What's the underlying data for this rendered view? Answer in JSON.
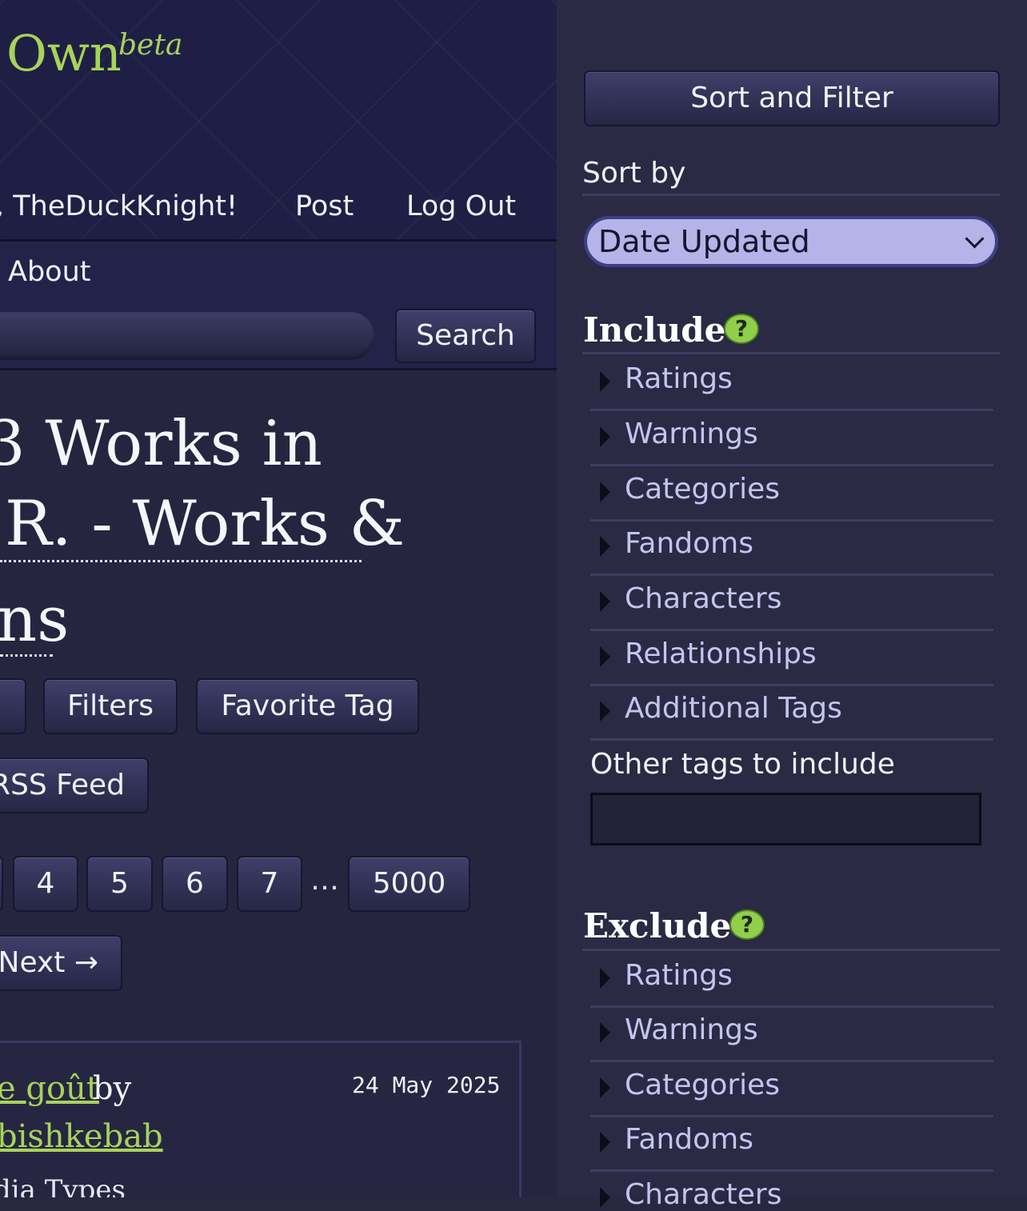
{
  "header": {
    "logo_text": "Own",
    "logo_badge": "beta",
    "greeting": ", TheDuckKnight!",
    "post_link": "Post",
    "logout_link": "Log Out"
  },
  "nav": {
    "about": "About",
    "search_button": "Search"
  },
  "page_heading": {
    "line1": "3 Works in",
    "line2": "R. - Works &",
    "line3": "ns"
  },
  "actions": {
    "partial": "",
    "filters": "Filters",
    "favorite_tag": "Favorite Tag",
    "rss_feed": "RSS Feed"
  },
  "pagination": {
    "partial": "",
    "pages": [
      "4",
      "5",
      "6",
      "7"
    ],
    "gap": "…",
    "last": "5000",
    "next": "Next →"
  },
  "work": {
    "title_partial": "e goût",
    "by": "by",
    "author_partial": "bishkebab",
    "date": "24 May 2025",
    "meta_partial": "dia Types"
  },
  "sidebar": {
    "title": "Sort and Filter",
    "sort_label": "Sort by",
    "sort_value": "Date Updated",
    "include_heading": "Include",
    "help_glyph": "?",
    "include_items": [
      "Ratings",
      "Warnings",
      "Categories",
      "Fandoms",
      "Characters",
      "Relationships",
      "Additional Tags"
    ],
    "other_tags_label": "Other tags to include",
    "exclude_heading": "Exclude",
    "exclude_items": [
      "Ratings",
      "Warnings",
      "Categories",
      "Fandoms",
      "Characters"
    ]
  },
  "colors": {
    "accent_green": "#a7d35a",
    "page_bg": "#27273f",
    "header_bg": "#1f1f45",
    "select_bg": "#b4b4e8",
    "filter_text": "#c4c4ef"
  }
}
